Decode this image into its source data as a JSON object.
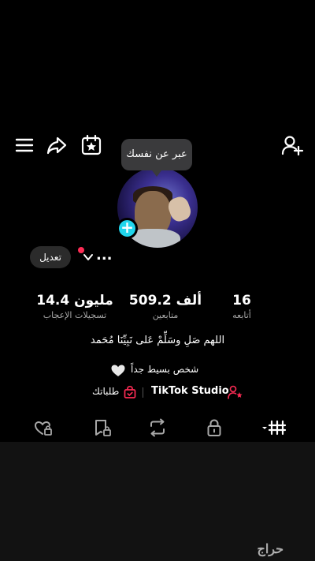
{
  "tooltip": {
    "text": "عبر عن نفسك"
  },
  "profile": {
    "edit_label": "تعديل",
    "username": "..."
  },
  "stats": {
    "likes": {
      "value": "14.4 مليون",
      "label": "تسجيلات الإعجاب"
    },
    "followers": {
      "value": "509.2 ألف",
      "label": "متابعين"
    },
    "following": {
      "value": "16",
      "label": "أتابعه"
    }
  },
  "bio": {
    "line1": "اللهم صَلِ وسَلِّمْ عَلى نَبِيِّنَا مُحَمد",
    "line2": "شخص بسيط جداً"
  },
  "links": {
    "orders": "طلباتك",
    "studio": "TikTok Studio"
  },
  "watermark": {
    "text": "حراج"
  },
  "colors": {
    "accent": "#20d5ec",
    "notification": "#fe2c55",
    "background": "#000000"
  },
  "icons": [
    "menu-icon",
    "share-icon",
    "calendar-star-icon",
    "add-user-icon",
    "heart-lock-icon",
    "bag-icon",
    "studio-icon",
    "chevron-down-icon"
  ]
}
